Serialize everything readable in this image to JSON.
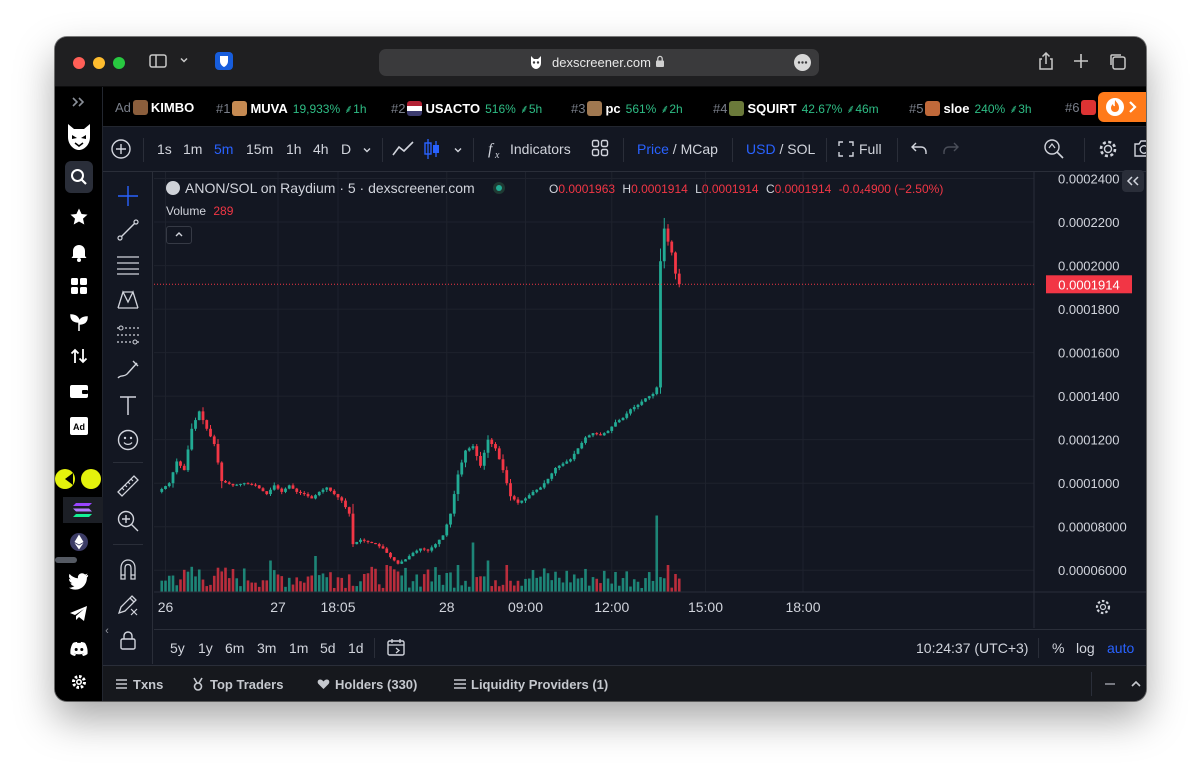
{
  "browser": {
    "url": "dexscreener.com"
  },
  "ticker": {
    "ad_label": "Ad",
    "ad_name": "KIMBO",
    "items": [
      {
        "rank": "#1",
        "name": "MUVA",
        "pct": "19,933%",
        "age": "1h"
      },
      {
        "rank": "#2",
        "name": "USACTO",
        "pct": "516%",
        "age": "5h"
      },
      {
        "rank": "#3",
        "name": "pc",
        "pct": "561%",
        "age": "2h"
      },
      {
        "rank": "#4",
        "name": "SQUIRT",
        "pct": "42.67%",
        "age": "46m"
      },
      {
        "rank": "#5",
        "name": "sloe",
        "pct": "240%",
        "age": "3h"
      },
      {
        "rank": "#6",
        "name": "",
        "pct": "",
        "age": ""
      }
    ]
  },
  "toolbar": {
    "intervals": [
      "1s",
      "1m",
      "5m",
      "15m",
      "1h",
      "4h",
      "D"
    ],
    "active_interval": "5m",
    "indicators_label": "Indicators",
    "price_label": "Price",
    "mcap_label": "MCap",
    "usd_label": "USD",
    "sol_label": "SOL",
    "full_label": "Full",
    "slash": "/"
  },
  "legend": {
    "title": "ANON/SOL on Raydium · 5 · dexscreener.com",
    "o_label": "O",
    "o_value": "0.0001963",
    "h_label": "H",
    "h_value": "0.0001914",
    "l_label": "L",
    "l_value": "0.0001914",
    "c_label": "C",
    "c_value": "0.0001914",
    "change": "-0.0₄4900 (−2.50%)",
    "volume_label": "Volume",
    "volume_value": "289"
  },
  "chart_data": {
    "type": "candlestick",
    "title": "ANON/SOL on Raydium · 5 · dexscreener.com",
    "y_ticks": [
      "0.0002400",
      "0.0002200",
      "0.0002000",
      "0.0001800",
      "0.0001600",
      "0.0001400",
      "0.0001200",
      "0.0001000",
      "0.00008000",
      "0.00006000"
    ],
    "y_tick_values": [
      0.00024,
      0.00022,
      0.0002,
      0.00018,
      0.00016,
      0.00014,
      0.00012,
      0.0001,
      8e-05,
      6e-05
    ],
    "ylim": [
      5e-05,
      0.000243
    ],
    "current_price": 0.0001914,
    "current_price_label": "0.0001914",
    "x_ticks": [
      "26",
      "27",
      "18:05",
      "28",
      "09:00",
      "12:00",
      "15:00",
      "18:00"
    ],
    "x_tick_index": [
      2,
      32,
      48,
      77,
      98,
      121,
      146,
      172
    ],
    "x_count": 180,
    "close_path": [
      [
        0,
        9.6e-05
      ],
      [
        3,
        0.0001
      ],
      [
        5,
        0.00011
      ],
      [
        7,
        0.000106
      ],
      [
        9,
        0.000125
      ],
      [
        11,
        0.000133
      ],
      [
        13,
        0.000125
      ],
      [
        15,
        0.000118
      ],
      [
        17,
        0.000101
      ],
      [
        20,
        9.9e-05
      ],
      [
        23,
        0.0001
      ],
      [
        26,
        9.9e-05
      ],
      [
        29,
        9.5e-05
      ],
      [
        31,
        9.9e-05
      ],
      [
        33,
        9.6e-05
      ],
      [
        35,
        9.9e-05
      ],
      [
        37,
        9.6e-05
      ],
      [
        39,
        9.5e-05
      ],
      [
        41,
        9.3e-05
      ],
      [
        43,
        9.6e-05
      ],
      [
        45,
        9.8e-05
      ],
      [
        47,
        9.5e-05
      ],
      [
        49,
        9.2e-05
      ],
      [
        51,
        8.6e-05
      ],
      [
        52,
        7.2e-05
      ],
      [
        54,
        7.4e-05
      ],
      [
        56,
        7.3e-05
      ],
      [
        58,
        7.2e-05
      ],
      [
        60,
        7e-05
      ],
      [
        62,
        6.6e-05
      ],
      [
        64,
        6.3e-05
      ],
      [
        66,
        6.5e-05
      ],
      [
        68,
        6.8e-05
      ],
      [
        70,
        7e-05
      ],
      [
        72,
        6.9e-05
      ],
      [
        74,
        7.2e-05
      ],
      [
        76,
        7.6e-05
      ],
      [
        78,
        8.6e-05
      ],
      [
        80,
        0.000104
      ],
      [
        82,
        0.000115
      ],
      [
        84,
        0.000117
      ],
      [
        86,
        0.000108
      ],
      [
        88,
        0.00012
      ],
      [
        90,
        0.000116
      ],
      [
        92,
        0.000106
      ],
      [
        94,
        9.4e-05
      ],
      [
        96,
        9.1e-05
      ],
      [
        98,
        9.3e-05
      ],
      [
        100,
        9.6e-05
      ],
      [
        102,
        9.8e-05
      ],
      [
        104,
        0.000102
      ],
      [
        106,
        0.000107
      ],
      [
        108,
        0.000109
      ],
      [
        110,
        0.000111
      ],
      [
        112,
        0.000116
      ],
      [
        114,
        0.000121
      ],
      [
        116,
        0.000123
      ],
      [
        118,
        0.000122
      ],
      [
        120,
        0.000124
      ],
      [
        122,
        0.000128
      ],
      [
        124,
        0.00013
      ],
      [
        126,
        0.000134
      ],
      [
        128,
        0.000136
      ],
      [
        130,
        0.000139
      ],
      [
        132,
        0.000141
      ],
      [
        133,
        0.000144
      ],
      [
        134,
        0.000202
      ],
      [
        135,
        0.000217
      ],
      [
        136,
        0.000211
      ],
      [
        137,
        0.000206
      ],
      [
        138,
        0.0001963
      ],
      [
        139,
        0.0001914
      ]
    ],
    "volume_spikes": [
      [
        9,
        0.28
      ],
      [
        11,
        0.25
      ],
      [
        15,
        0.18
      ],
      [
        30,
        0.35
      ],
      [
        42,
        0.4
      ],
      [
        46,
        0.22
      ],
      [
        55,
        0.2
      ],
      [
        61,
        0.3
      ],
      [
        72,
        0.25
      ],
      [
        80,
        0.3
      ],
      [
        84,
        0.55
      ],
      [
        88,
        0.35
      ],
      [
        93,
        0.3
      ],
      [
        99,
        0.15
      ],
      [
        120,
        0.15
      ],
      [
        133,
        0.85
      ],
      [
        136,
        0.3
      ],
      [
        138,
        0.2
      ]
    ]
  },
  "rangebar": {
    "ranges": [
      "5y",
      "1y",
      "6m",
      "3m",
      "1m",
      "5d",
      "1d"
    ],
    "time": "10:24:37 (UTC+3)",
    "pct_label": "%",
    "log_label": "log",
    "auto_label": "auto"
  },
  "bottomtabs": {
    "txns": "Txns",
    "top_traders": "Top Traders",
    "holders": "Holders (330)",
    "liquidity": "Liquidity Providers (1)"
  },
  "colors": {
    "up": "#22ab94",
    "down": "#f23645",
    "accent": "#2962ff",
    "background": "#131722"
  }
}
